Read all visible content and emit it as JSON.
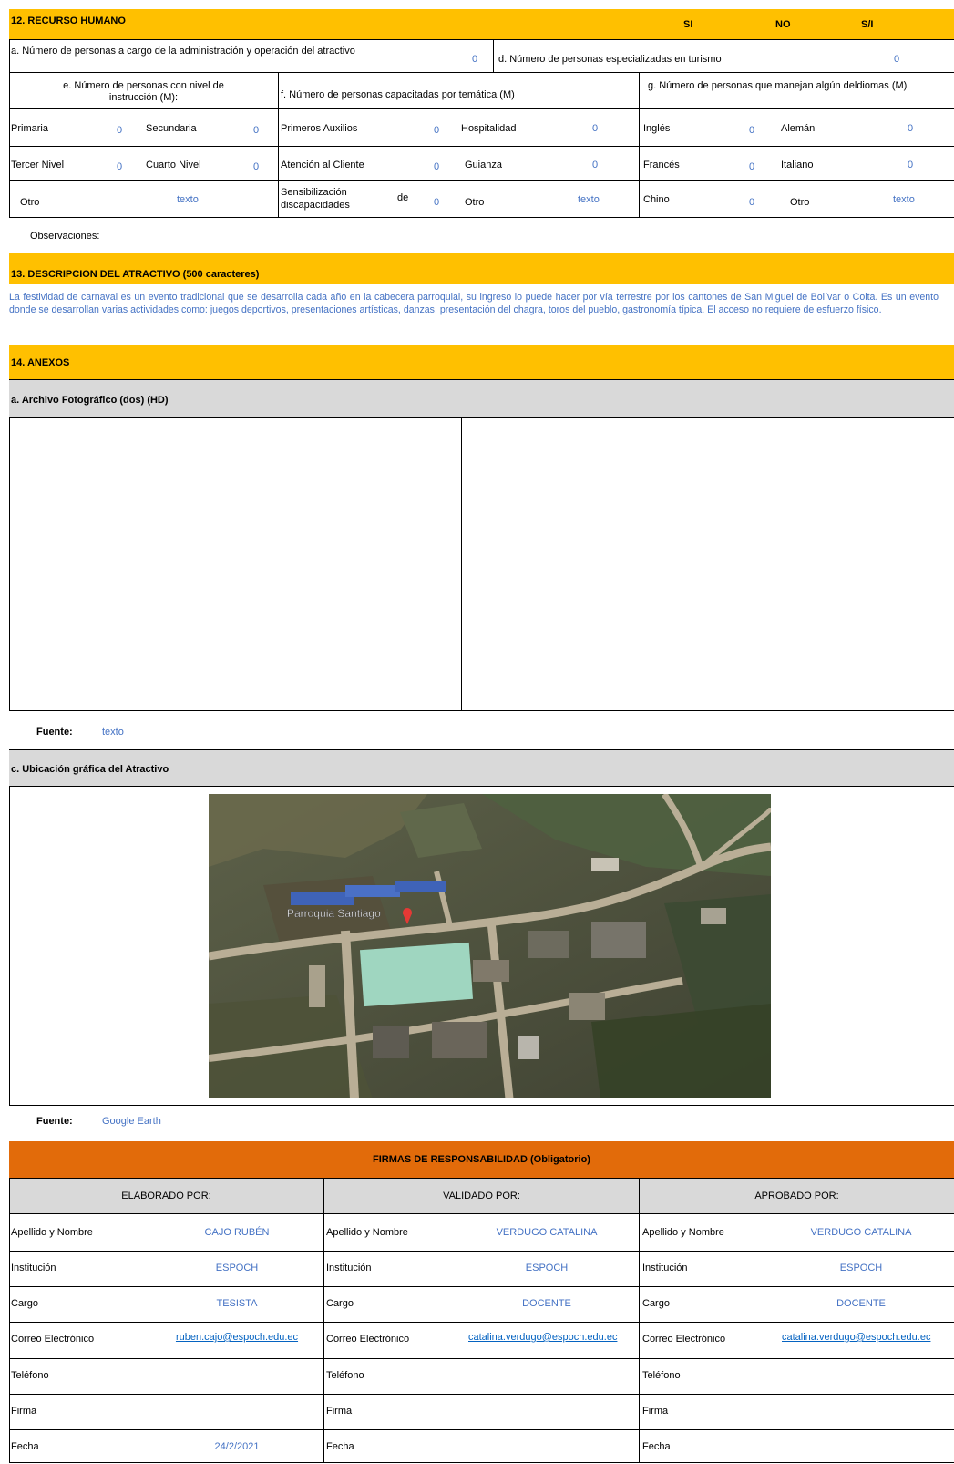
{
  "section12": {
    "title": "12. RECURSO HUMANO",
    "col_si": "SI",
    "col_no": "NO",
    "col_si_na": "S/I",
    "a_label": "a. Número de personas a cargo de la administración y operación del atractivo",
    "a_value": "0",
    "d_label": "d. Número de personas especializadas en turismo",
    "d_value": "0",
    "e_label_line1": "e. Número de personas con nivel de",
    "e_label_line2": "instrucción (M):",
    "f_label": "f. Número de personas capacitadas por temática (M)",
    "g_label": "g. Número de personas que manejan algún deldiomas (M)",
    "rows": [
      [
        {
          "label": "Primaria",
          "value": "0"
        },
        {
          "label": "Secundaria",
          "value": "0"
        },
        {
          "label": "Primeros Auxilios",
          "value": "0"
        },
        {
          "label": "Hospitalidad",
          "value": "0"
        },
        {
          "label": "Inglés",
          "value": "0"
        },
        {
          "label": "Alemán",
          "value": "0"
        }
      ],
      [
        {
          "label": "Tercer Nivel",
          "value": "0"
        },
        {
          "label": "Cuarto Nivel",
          "value": "0"
        },
        {
          "label": "Atención al Cliente",
          "value": "0"
        },
        {
          "label": "Guianza",
          "value": "0"
        },
        {
          "label": "Francés",
          "value": "0"
        },
        {
          "label": "Italiano",
          "value": "0"
        }
      ],
      [
        {
          "label": "Otro",
          "value": "texto"
        },
        {
          "label_line1": "Sensibilización",
          "label_de": "de",
          "label_line2": "discapacidades",
          "value": "0"
        },
        {
          "label": "Otro",
          "value": "texto"
        },
        {
          "label": "Chino",
          "value": "0"
        },
        {
          "label": "Otro",
          "value": "texto"
        }
      ]
    ],
    "observaciones": "Observaciones:"
  },
  "section13": {
    "title": "13. DESCRIPCION DEL ATRACTIVO (500 caracteres)",
    "text": "La festividad de carnaval es un  evento tradicional  que se desarrolla cada año en la cabecera parroquial,  su ingreso lo puede hacer por  vía terrestre por los  cantones de San Miguel de Bolívar o Colta. Es un evento donde se desarrollan varias actividades como: juegos deportivos, presentaciones artísticas, danzas, presentación del chagra, toros del pueblo, gastronomía típica. El acceso no requiere de esfuerzo físico."
  },
  "section14": {
    "title": "14. ANEXOS",
    "a_title": "a. Archivo Fotográfico (dos) (HD)",
    "fuente_label": "Fuente:",
    "fuente_photo": "texto",
    "c_title": "c. Ubicación gráfica del Atractivo",
    "map_label": "Parroquia Santiago",
    "fuente_map": "Google Earth"
  },
  "firmas": {
    "title": "FIRMAS DE RESPONSABILIDAD (Obligatorio)",
    "columns": [
      {
        "header": "ELABORADO POR:",
        "apellido": "CAJO RUBÉN",
        "institucion": "ESPOCH",
        "cargo": "TESISTA",
        "correo": "ruben.cajo@espoch.edu.ec",
        "fecha": "24/2/2021"
      },
      {
        "header": "VALIDADO POR:",
        "apellido": "VERDUGO CATALINA",
        "institucion": "ESPOCH",
        "cargo": "DOCENTE",
        "correo": "catalina.verdugo@espoch.edu.ec",
        "fecha": ""
      },
      {
        "header": "APROBADO POR:",
        "apellido": "VERDUGO CATALINA",
        "institucion": "ESPOCH",
        "cargo": "DOCENTE",
        "correo": "catalina.verdugo@espoch.edu.ec",
        "fecha": ""
      }
    ],
    "labels": {
      "apellido": "Apellido y Nombre",
      "institucion": "Institución",
      "cargo": "Cargo",
      "correo": "Correo Electrónico",
      "telefono": "Teléfono",
      "firma": "Firma",
      "fecha": "Fecha"
    }
  },
  "colors": {
    "section_header": "#ffc000",
    "subheader": "#d9d9d9",
    "firmas_header": "#e26b0a",
    "value_text": "#4472c4",
    "link": "#0563c1"
  }
}
